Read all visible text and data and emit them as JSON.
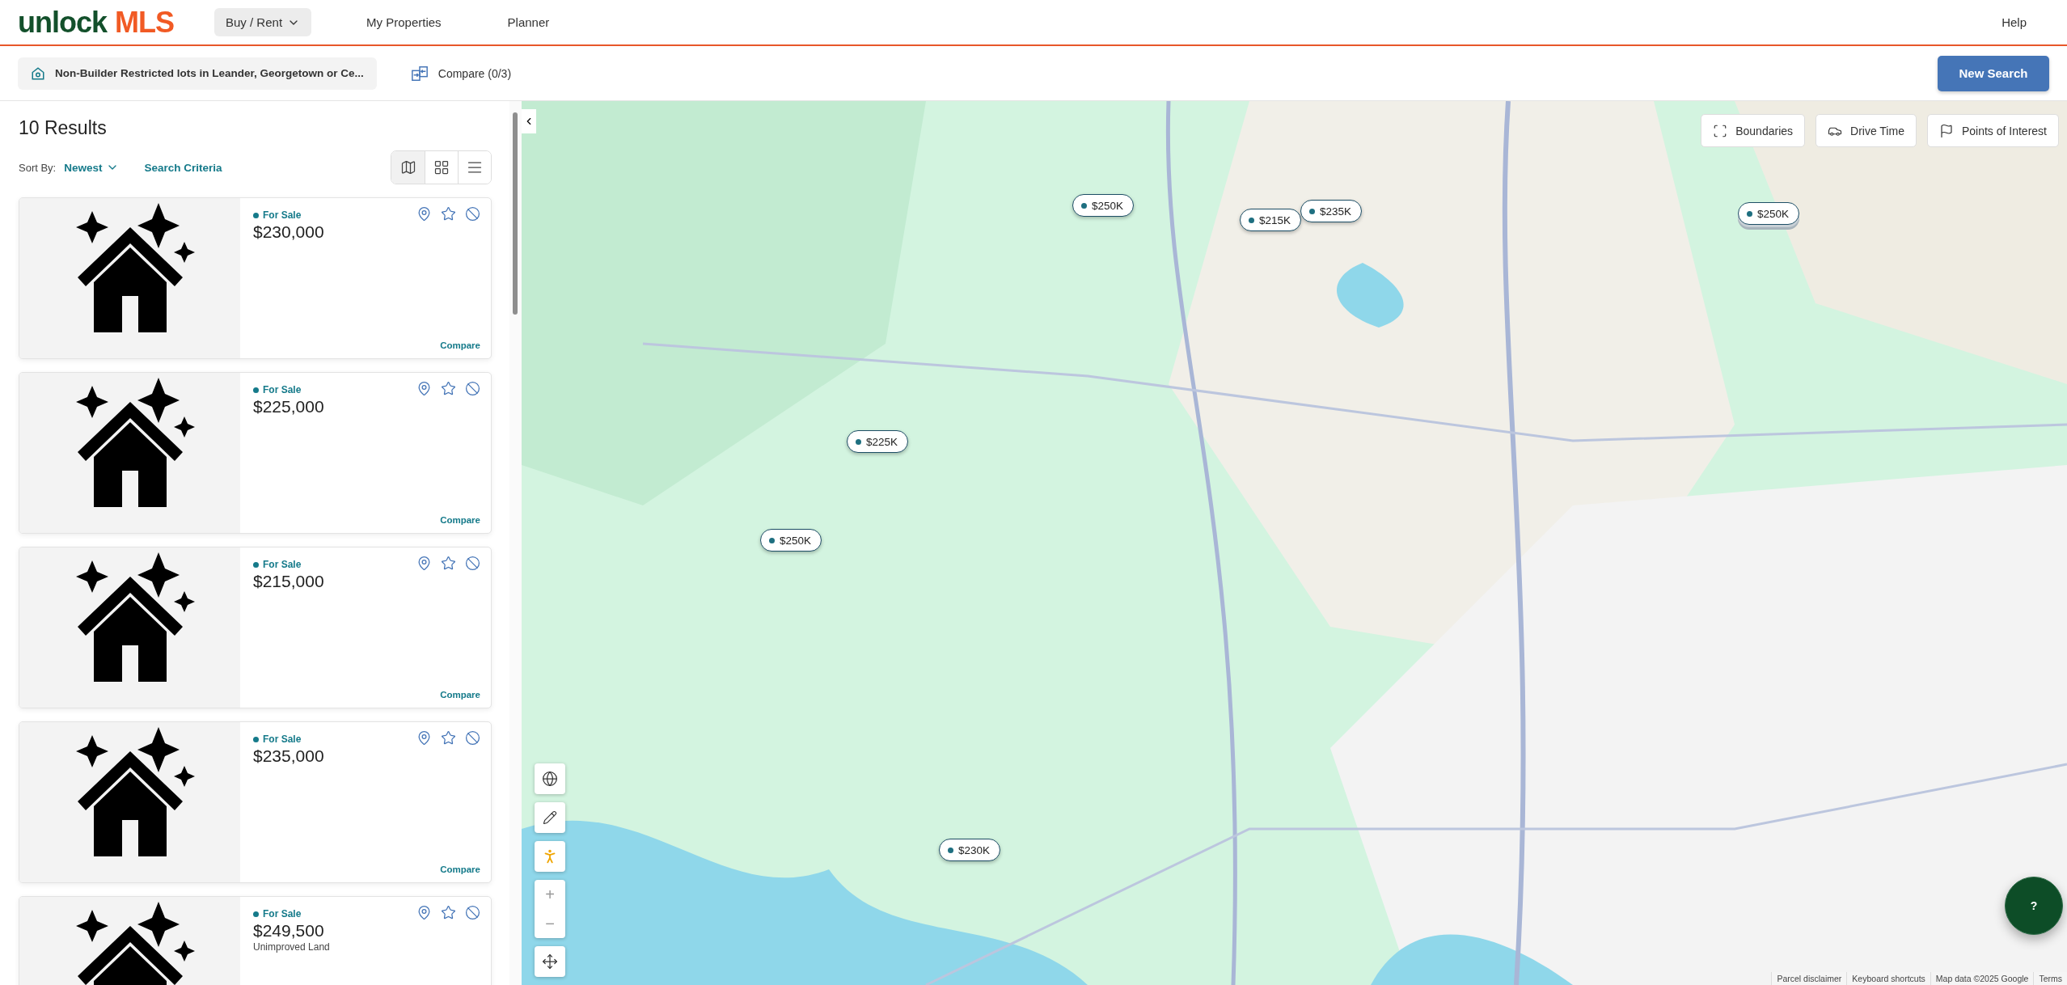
{
  "header": {
    "logo": {
      "first": "unlock",
      "second": "MLS"
    },
    "nav": [
      {
        "label": "Buy / Rent",
        "kind": "dropdown",
        "selected": true
      },
      {
        "label": "My Properties",
        "kind": "link",
        "selected": false
      },
      {
        "label": "Planner",
        "kind": "link",
        "selected": false
      }
    ],
    "help": "Help"
  },
  "toolbar": {
    "saved_search": "Non-Builder Restricted lots in Leander, Georgetown or Ce...",
    "compare": "Compare (0/3)",
    "new_search": "New Search"
  },
  "results": {
    "count": "10 Results",
    "sort_label": "Sort By:",
    "sort_value": "Newest",
    "criteria": "Search Criteria",
    "views": [
      {
        "kind": "map",
        "selected": true
      },
      {
        "kind": "grid",
        "selected": false
      },
      {
        "kind": "list",
        "selected": false
      }
    ],
    "listings": [
      {
        "status": "For Sale",
        "price": "$230,000",
        "compare": "Compare"
      },
      {
        "status": "For Sale",
        "price": "$225,000",
        "compare": "Compare"
      },
      {
        "status": "For Sale",
        "price": "$215,000",
        "compare": "Compare"
      },
      {
        "status": "For Sale",
        "price": "$235,000",
        "compare": "Compare"
      },
      {
        "status": "For Sale",
        "price": "$249,500",
        "type": "Unimproved Land"
      }
    ]
  },
  "map": {
    "tools": [
      {
        "kind": "boundaries",
        "label": "Boundaries"
      },
      {
        "kind": "drive",
        "label": "Drive Time"
      },
      {
        "kind": "poi",
        "label": "Points of Interest"
      }
    ],
    "markers": [
      {
        "price": "$250K",
        "stacked": false
      },
      {
        "price": "$215K",
        "stacked": false
      },
      {
        "price": "$235K",
        "stacked": false
      },
      {
        "price": "$250K",
        "stacked": true
      },
      {
        "price": "$225K",
        "stacked": false
      },
      {
        "price": "$250K",
        "stacked": false
      },
      {
        "price": "$230K",
        "stacked": false
      }
    ],
    "zoom_in": "+",
    "zoom_out": "−",
    "attribution": [
      "Parcel disclaimer",
      "Keyboard shortcuts",
      "Map data ©2025 Google",
      "Terms"
    ],
    "help_button": "?"
  }
}
